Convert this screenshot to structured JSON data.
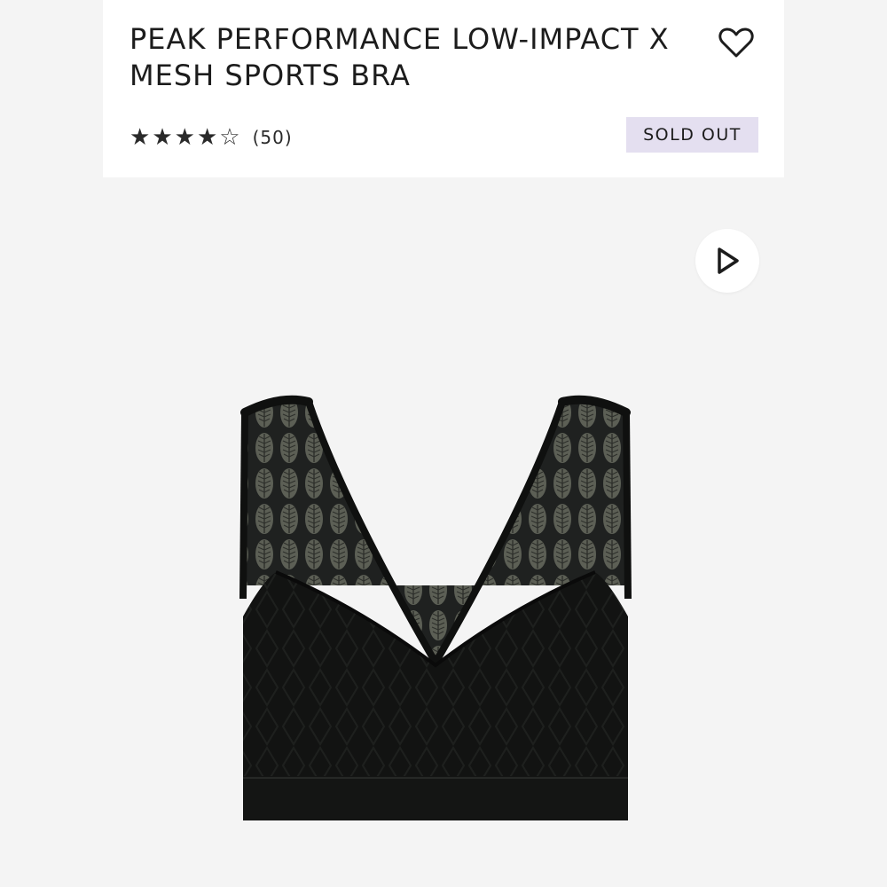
{
  "product": {
    "title": "PEAK PERFORMANCE LOW-IMPACT X MESH SPORTS BRA",
    "rating": 4,
    "rating_max": 5,
    "review_count": "(50)",
    "status_badge": "SOLD OUT"
  },
  "icons": {
    "wishlist": "heart-outline-icon",
    "video": "play-icon",
    "star_filled": "★",
    "star_empty": "☆"
  },
  "colors": {
    "background": "#f4f4f4",
    "card": "#ffffff",
    "badge": "#e4dff0",
    "text": "#1c1c1c"
  }
}
